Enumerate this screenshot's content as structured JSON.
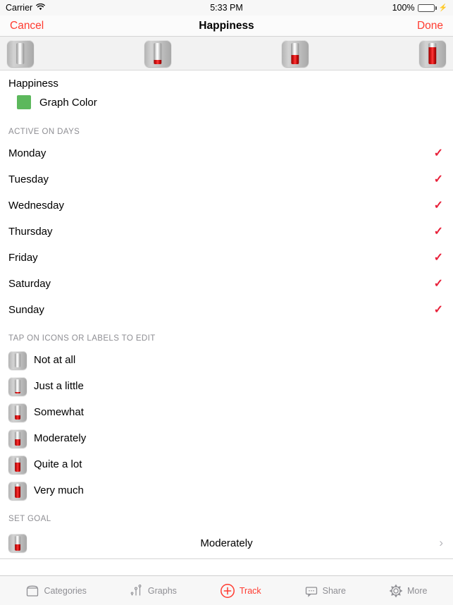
{
  "statusbar": {
    "carrier": "Carrier",
    "wifi_icon": "wifi-icon",
    "time": "5:33 PM",
    "battery_percent": "100%",
    "battery_level": 100,
    "charging": true
  },
  "navbar": {
    "cancel_label": "Cancel",
    "title": "Happiness",
    "done_label": "Done"
  },
  "icon_strip": {
    "icons": [
      {
        "name": "thermometer-icon-empty",
        "fill": 0
      },
      {
        "name": "thermometer-icon-low",
        "fill": 20
      },
      {
        "name": "thermometer-icon-mid",
        "fill": 45
      },
      {
        "name": "thermometer-icon-high",
        "fill": 80
      }
    ]
  },
  "tracker": {
    "name": "Happiness",
    "graph_color_label": "Graph Color",
    "graph_color": "#5cb85c"
  },
  "active_on_days": {
    "header": "ACTIVE ON DAYS",
    "days": [
      {
        "label": "Monday",
        "checked": true
      },
      {
        "label": "Tuesday",
        "checked": true
      },
      {
        "label": "Wednesday",
        "checked": true
      },
      {
        "label": "Thursday",
        "checked": true
      },
      {
        "label": "Friday",
        "checked": true
      },
      {
        "label": "Saturday",
        "checked": true
      },
      {
        "label": "Sunday",
        "checked": true
      }
    ],
    "check_glyph": "✓",
    "check_color": "#e8213a"
  },
  "levels": {
    "header": "TAP ON ICONS OR LABELS TO EDIT",
    "items": [
      {
        "label": "Not at all",
        "fill": 0
      },
      {
        "label": "Just a little",
        "fill": 14
      },
      {
        "label": "Somewhat",
        "fill": 30
      },
      {
        "label": "Moderately",
        "fill": 45
      },
      {
        "label": "Quite a lot",
        "fill": 65
      },
      {
        "label": "Very much",
        "fill": 82
      }
    ]
  },
  "goal": {
    "header": "SET GOAL",
    "value": "Moderately",
    "fill": 45,
    "chevron_glyph": "›"
  },
  "tabbar": {
    "tabs": [
      {
        "label": "Categories",
        "icon": "box-icon",
        "active": false
      },
      {
        "label": "Graphs",
        "icon": "scatter-plot-icon",
        "active": false
      },
      {
        "label": "Track",
        "icon": "plus-circle-icon",
        "active": true
      },
      {
        "label": "Share",
        "icon": "speech-bubble-icon",
        "active": false
      },
      {
        "label": "More",
        "icon": "gear-icon",
        "active": false
      }
    ],
    "active_color": "#ff3b30",
    "inactive_color": "#8e8e93"
  }
}
